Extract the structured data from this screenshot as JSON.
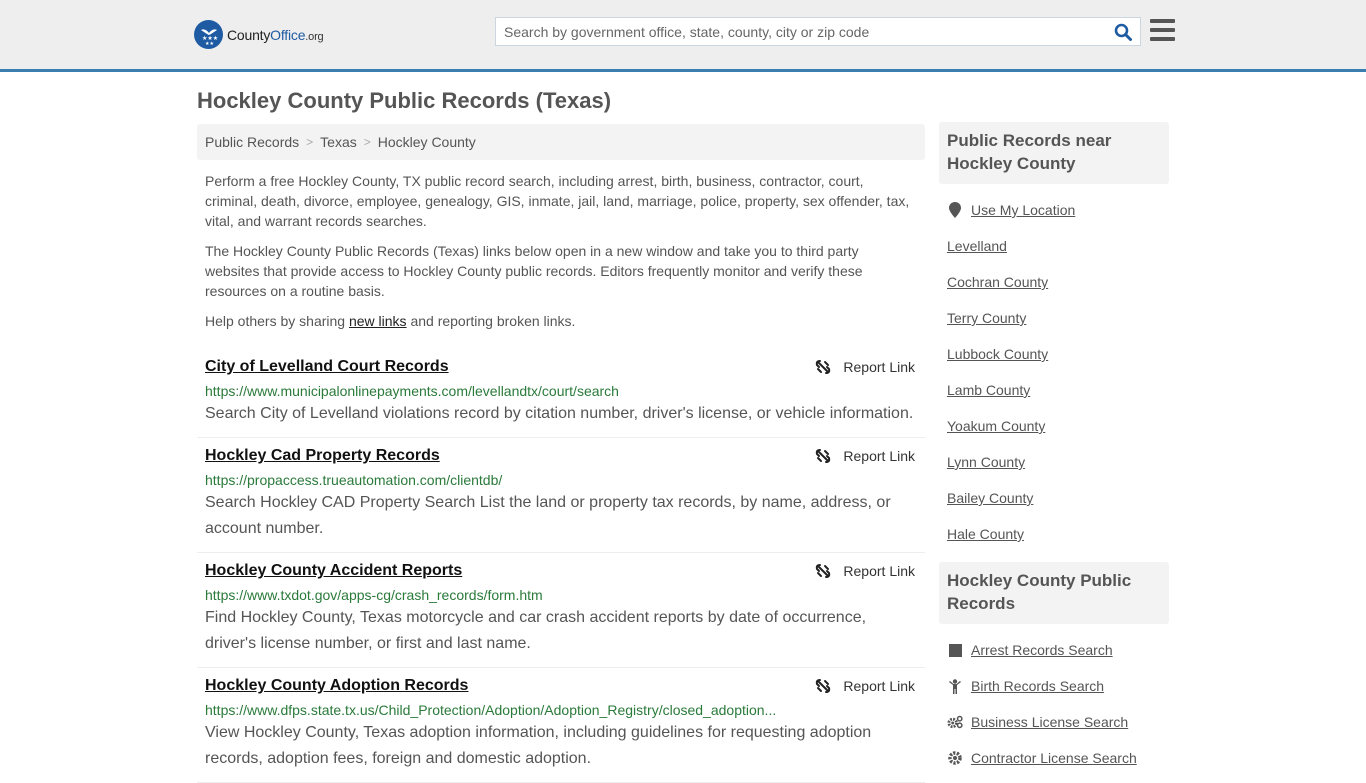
{
  "header": {
    "logo": {
      "name_part1": "County",
      "name_part2": "Office",
      "name_part3": ".org"
    },
    "search": {
      "placeholder": "Search by government office, state, county, city or zip code",
      "value": ""
    },
    "colors": {
      "brand_blue": "#1f5ba3",
      "header_border": "#3a7fb0"
    }
  },
  "page": {
    "title": "Hockley County Public Records (Texas)"
  },
  "breadcrumb": [
    {
      "label": "Public Records"
    },
    {
      "label": "Texas"
    },
    {
      "label": "Hockley County"
    }
  ],
  "breadcrumb_separator": ">",
  "intro": {
    "p1": "Perform a free Hockley County, TX public record search, including arrest, birth, business, contractor, court, criminal, death, divorce, employee, genealogy, GIS, inmate, jail, land, marriage, police, property, sex offender, tax, vital, and warrant records searches.",
    "p2": "The Hockley County Public Records (Texas) links below open in a new window and take you to third party websites that provide access to Hockley County public records. Editors frequently monitor and verify these resources on a routine basis.",
    "p3_before": "Help others by sharing ",
    "p3_link": "new links",
    "p3_after": " and reporting broken links."
  },
  "records": [
    {
      "title": "City of Levelland Court Records",
      "url": "https://www.municipalonlinepayments.com/levellandtx/court/search",
      "description": "Search City of Levelland violations record by citation number, driver's license, or vehicle information.",
      "report_label": "Report Link"
    },
    {
      "title": "Hockley Cad Property Records",
      "url": "https://propaccess.trueautomation.com/clientdb/",
      "description": "Search Hockley CAD Property Search List the land or property tax records, by name, address, or account number.",
      "report_label": "Report Link"
    },
    {
      "title": "Hockley County Accident Reports",
      "url": "https://www.txdot.gov/apps-cg/crash_records/form.htm",
      "description": "Find Hockley County, Texas motorcycle and car crash accident reports by date of occurrence, driver's license number, or first and last name.",
      "report_label": "Report Link"
    },
    {
      "title": "Hockley County Adoption Records",
      "url": "https://www.dfps.state.tx.us/Child_Protection/Adoption/Adoption_Registry/closed_adoption...",
      "description": "View Hockley County, Texas adoption information, including guidelines for requesting adoption records, adoption fees, foreign and domestic adoption.",
      "report_label": "Report Link"
    }
  ],
  "sidebar": {
    "nearby": {
      "heading": "Public Records near Hockley County",
      "use_location": {
        "label": "Use My Location",
        "icon": "map-marker-icon"
      },
      "items": [
        {
          "label": "Levelland"
        },
        {
          "label": "Cochran County"
        },
        {
          "label": "Terry County"
        },
        {
          "label": "Lubbock County"
        },
        {
          "label": "Lamb County"
        },
        {
          "label": "Yoakum County"
        },
        {
          "label": "Lynn County"
        },
        {
          "label": "Bailey County"
        },
        {
          "label": "Hale County"
        }
      ]
    },
    "county_records": {
      "heading": "Hockley County Public Records",
      "items": [
        {
          "label": "Arrest Records Search",
          "icon": "square-icon"
        },
        {
          "label": "Birth Records Search",
          "icon": "child-icon"
        },
        {
          "label": "Business License Search",
          "icon": "gears-icon"
        },
        {
          "label": "Contractor License Search",
          "icon": "gear-icon"
        }
      ]
    }
  }
}
